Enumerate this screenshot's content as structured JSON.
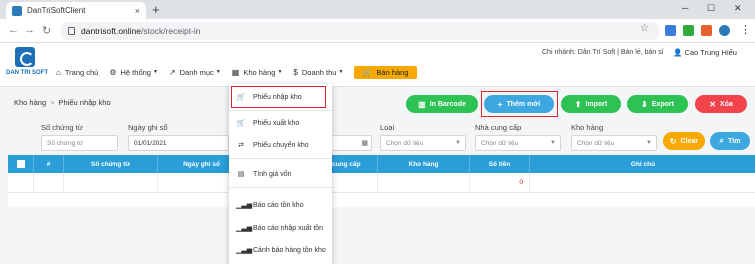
{
  "browser": {
    "tab_title": "DanTriSoftClient",
    "tab_close": "×",
    "new_tab": "+",
    "url_host": "dantrisoft.online",
    "url_path": "/stock/receipt-in",
    "min": "─",
    "max": "☐",
    "close": "✕"
  },
  "header": {
    "brand": "DAN TRI SOFT",
    "branch": "Chi nhánh: Dân Trí Soft | Bán lẻ, bán sỉ",
    "user": "Cao Trung Hiếu",
    "menu": [
      {
        "label": "Trang chủ",
        "icon": "home-icon"
      },
      {
        "label": "Hệ thống",
        "icon": "gears-icon"
      },
      {
        "label": "Danh mục",
        "icon": "wrench-icon"
      },
      {
        "label": "Kho hàng",
        "icon": "warehouse-icon"
      },
      {
        "label": "Doanh thu",
        "icon": "dollar-icon"
      },
      {
        "label": "Bán hàng",
        "icon": "cart-icon"
      }
    ]
  },
  "breadcrumb": {
    "root": "Kho hàng",
    "sep": ">",
    "current": "Phiếu nhập kho"
  },
  "actions": {
    "barcode": "In Barcode",
    "add": "Thêm mới",
    "import": "Import",
    "export": "Export",
    "delete": "Xóa",
    "clear": "Clear",
    "search": "Tìm"
  },
  "filters": {
    "doc_no_label": "Số chứng từ",
    "doc_no_placeholder": "Số chứng từ",
    "date_label": "Ngày ghi sổ",
    "date_value": "01/01/2021",
    "type_label": "Loại",
    "type_value": "Chọn dữ liệu",
    "supplier_label": "Nhà cung cấp",
    "supplier_value": "Chọn dữ liệu",
    "warehouse_label": "Kho hàng",
    "warehouse_value": "Chọn dữ liệu"
  },
  "table": {
    "headers": [
      "#",
      "Số chứng từ",
      "Ngày ghi sổ",
      "",
      "Nhà cung cấp",
      "Kho hàng",
      "Số tiền",
      "Ghi chú"
    ],
    "total_amount": "0"
  },
  "dropdown": {
    "items": [
      {
        "label": "Phiếu nhập kho",
        "icon": "cart-icon"
      },
      {
        "label": "Phiếu xuất kho",
        "icon": "cart-icon"
      },
      {
        "label": "Phiếu chuyển kho",
        "icon": "transfer-icon"
      },
      {
        "label": "Tính giá vốn",
        "icon": "calculator-icon"
      },
      {
        "label": "Báo cáo tồn kho",
        "icon": "bar-signal-icon"
      },
      {
        "label": "Báo cáo nhập xuất tồn",
        "icon": "bar-signal-icon"
      },
      {
        "label": "Cảnh báo hàng tồn kho",
        "icon": "bar-signal-icon"
      }
    ]
  },
  "colors": {
    "green": "#2dc253",
    "blue": "#3da7e0",
    "red": "#f0434c",
    "orange": "#f7a900",
    "table_head": "#2b9ed8"
  }
}
